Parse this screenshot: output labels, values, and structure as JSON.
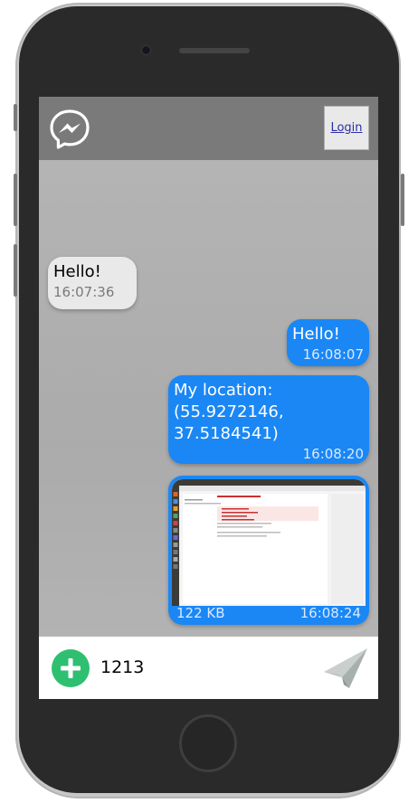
{
  "header": {
    "logo_icon": "messenger-bolt-icon",
    "login_label": "Login"
  },
  "messages": [
    {
      "direction": "incoming",
      "text": "Hello!",
      "time": "16:07:36"
    },
    {
      "direction": "outgoing",
      "text": "Hello!",
      "time": "16:08:07"
    },
    {
      "direction": "outgoing",
      "text_lines": [
        "My location:",
        "(55.9272146,",
        "37.5184541)"
      ],
      "time": "16:08:20"
    },
    {
      "direction": "outgoing",
      "type": "image",
      "size": "122 KB",
      "time": "16:08:24"
    }
  ],
  "composer": {
    "add_icon": "plus-circle-icon",
    "input_value": "1213",
    "send_icon": "paper-plane-icon"
  },
  "colors": {
    "header": "#7a7a7a",
    "chat_bg": "#b1b1b1",
    "outgoing_bubble": "#1a87f5",
    "incoming_bubble": "#e9e9e9",
    "add_button": "#2fbf71"
  }
}
